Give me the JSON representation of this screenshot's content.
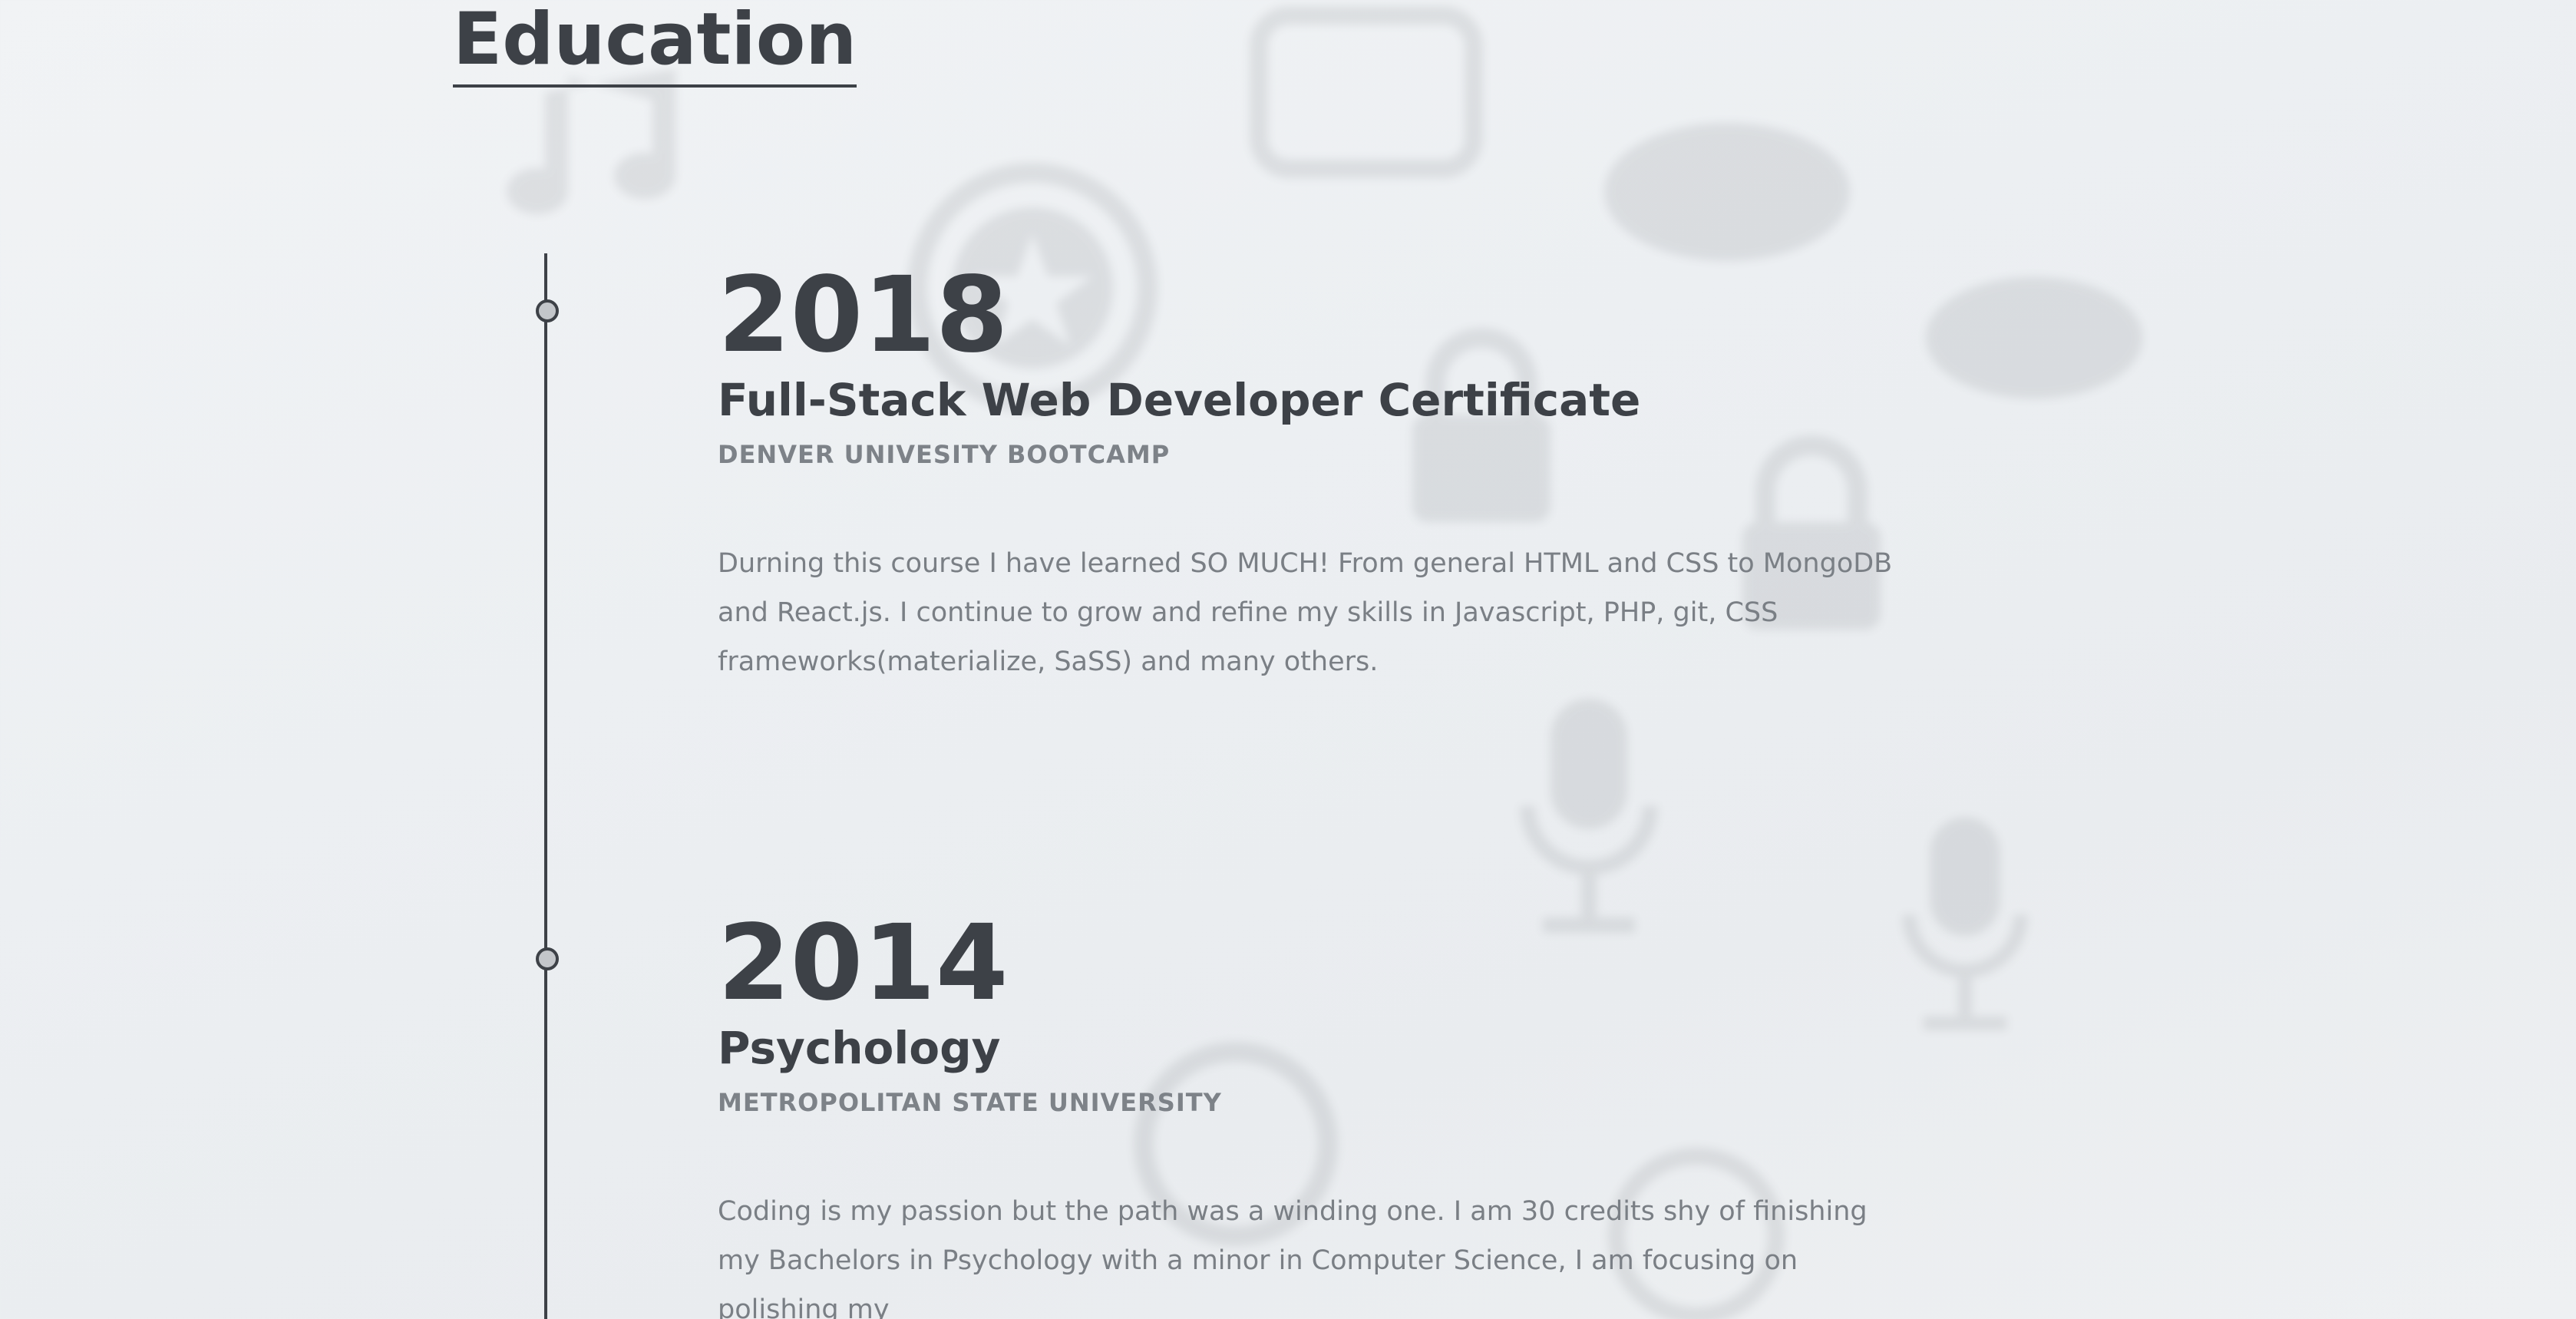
{
  "section": {
    "title": "Education"
  },
  "entries": [
    {
      "year": "2018",
      "title": "Full-Stack Web Developer Certificate",
      "school": "DENVER UNIVESITY BOOTCAMP",
      "description": "Durning this course I have learned SO MUCH! From general HTML and CSS to MongoDB and React.js. I continue to grow and refine my skills in Javascript, PHP, git, CSS frameworks(materialize, SaSS) and many others."
    },
    {
      "year": "2014",
      "title": "Psychology",
      "school": "METROPOLITAN STATE UNIVERSITY",
      "description": "Coding is my passion but the path was a winding one. I am 30 credits shy of finishing my Bachelors in Psychology with a minor in Computer Science, I am focusing on polishing my"
    }
  ],
  "background_icons": [
    "music-note-icon",
    "star-badge-icon",
    "lock-icon",
    "microphone-icon",
    "eye-icon",
    "leaf-icon"
  ],
  "colors": {
    "text_dark": "#3d4147",
    "text_muted": "#7a7f85",
    "background": "#eceff2"
  }
}
